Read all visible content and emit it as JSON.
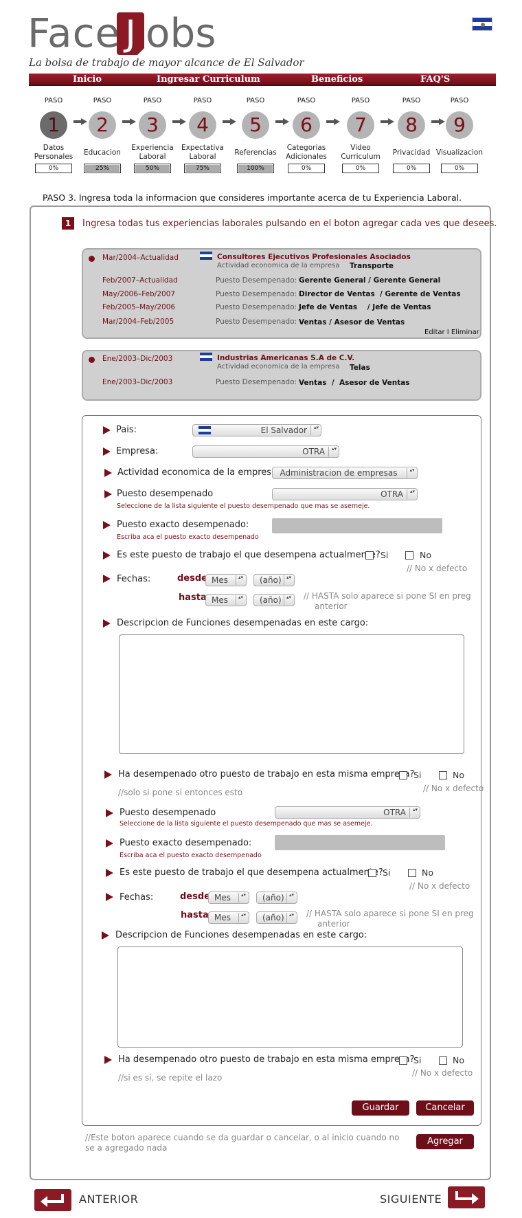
{
  "brand": {
    "face": "Face",
    "j": "J",
    "obs": "obs",
    "tagline": "La bolsa de trabajo de mayor alcance de El Salvador"
  },
  "nav": [
    "Inicio",
    "Ingresar Curriculum",
    "Beneficios",
    "FAQ'S"
  ],
  "steps": [
    {
      "paso": "PASO",
      "num": "1",
      "label": "Datos Personales",
      "progress": "0%",
      "fill": 0
    },
    {
      "paso": "PASO",
      "num": "2",
      "label": "Educacion",
      "progress": "25%",
      "fill": 1
    },
    {
      "paso": "PASO",
      "num": "3",
      "label": "Experiencia Laboral",
      "progress": "50%",
      "fill": 1
    },
    {
      "paso": "PASO",
      "num": "4",
      "label": "Expectativa Laboral",
      "progress": "75%",
      "fill": 1
    },
    {
      "paso": "PASO",
      "num": "5",
      "label": "Referencias",
      "progress": "100%",
      "fill": 1
    },
    {
      "paso": "PASO",
      "num": "6",
      "label": "Categorias Adicionales",
      "progress": "0%",
      "fill": 0
    },
    {
      "paso": "PASO",
      "num": "7",
      "label": "Video Curriculum",
      "progress": "0%",
      "fill": 0
    },
    {
      "paso": "PASO",
      "num": "8",
      "label": "Privacidad",
      "progress": "0%",
      "fill": 0
    },
    {
      "paso": "PASO",
      "num": "9",
      "label": "Visualizacion",
      "progress": "0%",
      "fill": 0
    }
  ],
  "instruction": "PASO 3. Ingresa toda la informacion que consideres importante acerca de tu Experiencia Laboral.",
  "section": {
    "num": "1",
    "text": "Ingresa todas tus experiencias laborales pulsando en el boton agregar cada ves que desees."
  },
  "card1": {
    "period": "Mar/2004–Actualidad",
    "company": "Consultores Ejecutivos Profesionales Asociados",
    "activity_label": "Actividad economica de la empresa",
    "activity": "Transporte",
    "rows": [
      {
        "period": "Feb/2007–Actualidad",
        "label": "Puesto Desempenado:",
        "value": "Gerente General / Gerente General"
      },
      {
        "period": "May/2006–Feb/2007",
        "label": "Puesto Desempenado:",
        "value": "Director de Ventas  / Gerente de Ventas"
      },
      {
        "period": "Feb/2005–May/2006",
        "label": "Puesto Desempenado:",
        "value": "Jefe de Ventas    / Jefe de Ventas"
      },
      {
        "period": "Mar/2004–Feb/2005",
        "label": "Puesto Desempenado:",
        "value": "Ventas / Asesor de Ventas"
      }
    ],
    "actions": "Editar I Eliminar"
  },
  "card2": {
    "period": "Ene/2003–Dic/2003",
    "company": "Industrias Americanas S.A de C.V.",
    "activity_label": "Actividad economica de la empresa",
    "activity": "Telas",
    "rows": [
      {
        "period": "Ene/2003–Dic/2003",
        "label": "Puesto Desempenado:",
        "value": "Ventas  /  Asesor de Ventas"
      }
    ]
  },
  "form": {
    "pais_label": "Pais:",
    "pais_value": "El Salvador",
    "empresa_label": "Empresa:",
    "empresa_value": "OTRA",
    "actividad_label": "Actividad economica de la empresa:",
    "actividad_value": "Administracion de empresas",
    "puesto_label": "Puesto desempenado",
    "puesto_value": "OTRA",
    "puesto_hint": "Seleccione de la lista siguiente el puesto desempenado que mas se asemeje.",
    "exacto_label": "Puesto exacto desempenado:",
    "exacto_hint": "Escriba aca el puesto exacto desempenado",
    "actual_q": "Es este puesto de trabajo el que desempena actualmente?",
    "si": "Si",
    "no": "No",
    "no_default": "// No x defecto",
    "fechas": "Fechas:",
    "desde": "desde",
    "hasta": "hasta",
    "mes": "Mes",
    "anio": "(año)",
    "hasta_note": "// HASTA solo aparece si pone SI en preg",
    "hasta_note2": "anterior",
    "desc_label": "Descripcion de Funciones desempenadas en este cargo:",
    "otro_q": "Ha desempenado otro puesto de trabajo en esta misma empresa?",
    "note_solo": "//solo si pone si entonces esto",
    "note_lazo": "//si es si, se repite el lazo",
    "guardar": "Guardar",
    "cancelar": "Cancelar"
  },
  "agregar_note": "//Este boton aparece cuando se da guardar o cancelar, o al inicio cuando no se a agregado nada",
  "agregar": "Agregar",
  "anterior": "ANTERIOR",
  "siguiente": "SIGUIENTE"
}
